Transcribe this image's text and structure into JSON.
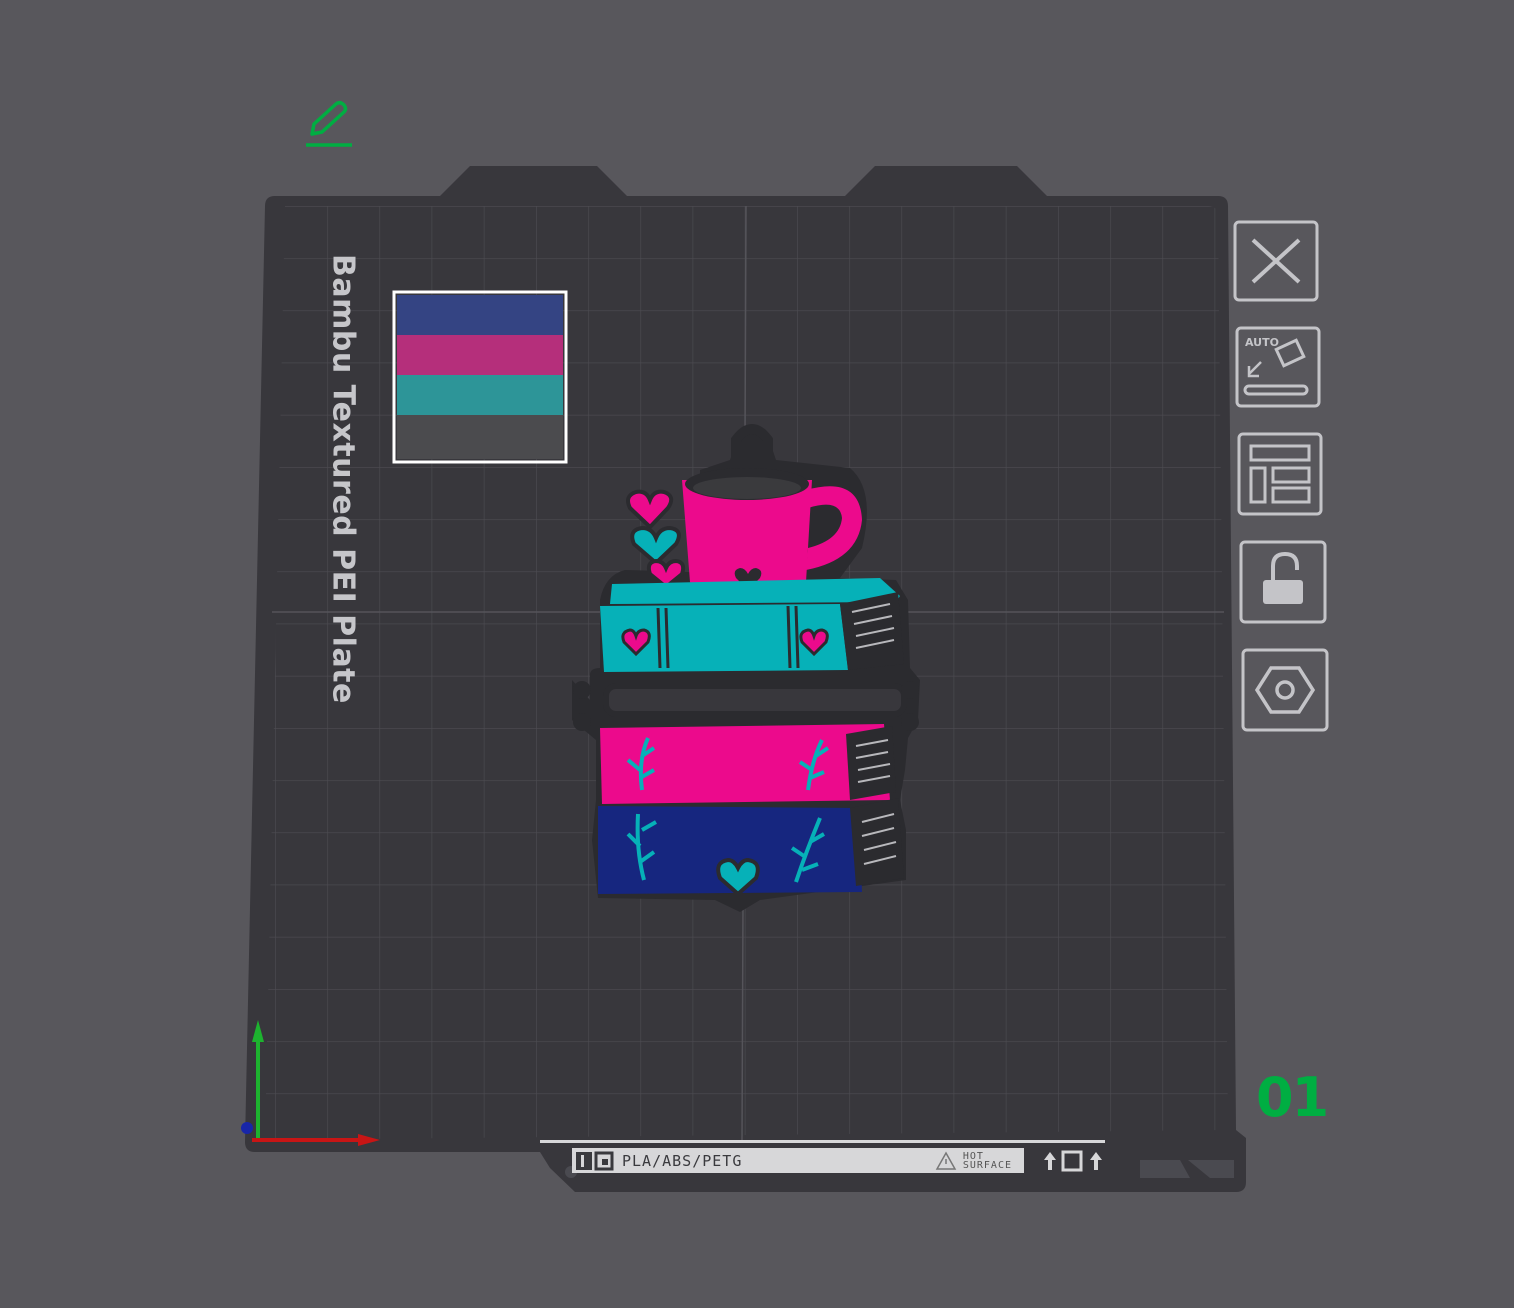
{
  "plate": {
    "name": "Bambu Textured PEI Plate",
    "number": "01",
    "material_label": "PLA/ABS/PETG",
    "hot_surface_line1": "HOT",
    "hot_surface_line2": "SURFACE"
  },
  "toolbar": {
    "auto_label": "AUTO",
    "buttons": [
      "close-icon",
      "auto-orient-icon",
      "arrange-icon",
      "lock-icon",
      "settings-icon"
    ]
  },
  "filament_swatch": [
    "#344483",
    "#b52f7b",
    "#2d9598",
    "#4b4b4e"
  ],
  "colors": {
    "background": "#58575c",
    "plate": "#38373c",
    "grid": "#4b4a50",
    "accent": "#00ae42",
    "model_pink": "#ec0a8c",
    "model_teal": "#06b1b8",
    "model_navy": "#16267f",
    "model_outline": "#2b2b2f"
  }
}
